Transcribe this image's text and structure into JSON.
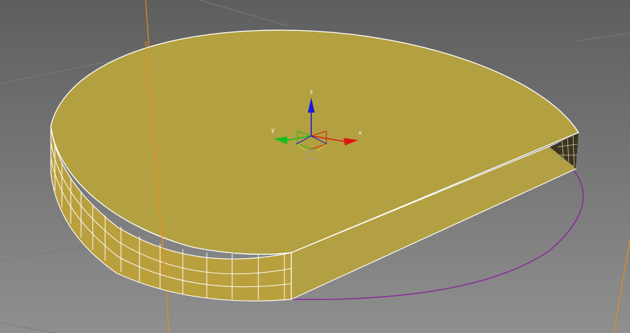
{
  "viewport": {
    "background_top": "#5e5e5e",
    "background_bottom": "#8f8f8f",
    "grid_line_color": "#7b7b7b",
    "grid_major_color": "#979797"
  },
  "object": {
    "type": "sliced cylinder",
    "face_color": "#b3a040",
    "side_color": "#ba9f3d",
    "cut_face_color": "#b2a043",
    "edge_color": "#ffffff",
    "interior_color": "#3a3420",
    "slice_circle_color": "#8a2a9a"
  },
  "gizmo": {
    "x_label": "x",
    "y_label": "y",
    "z_label": "z",
    "x_color": "#e01414",
    "y_color": "#10c020",
    "z_color": "#1a1ad8"
  },
  "guides": {
    "color": "#f08a1a"
  }
}
